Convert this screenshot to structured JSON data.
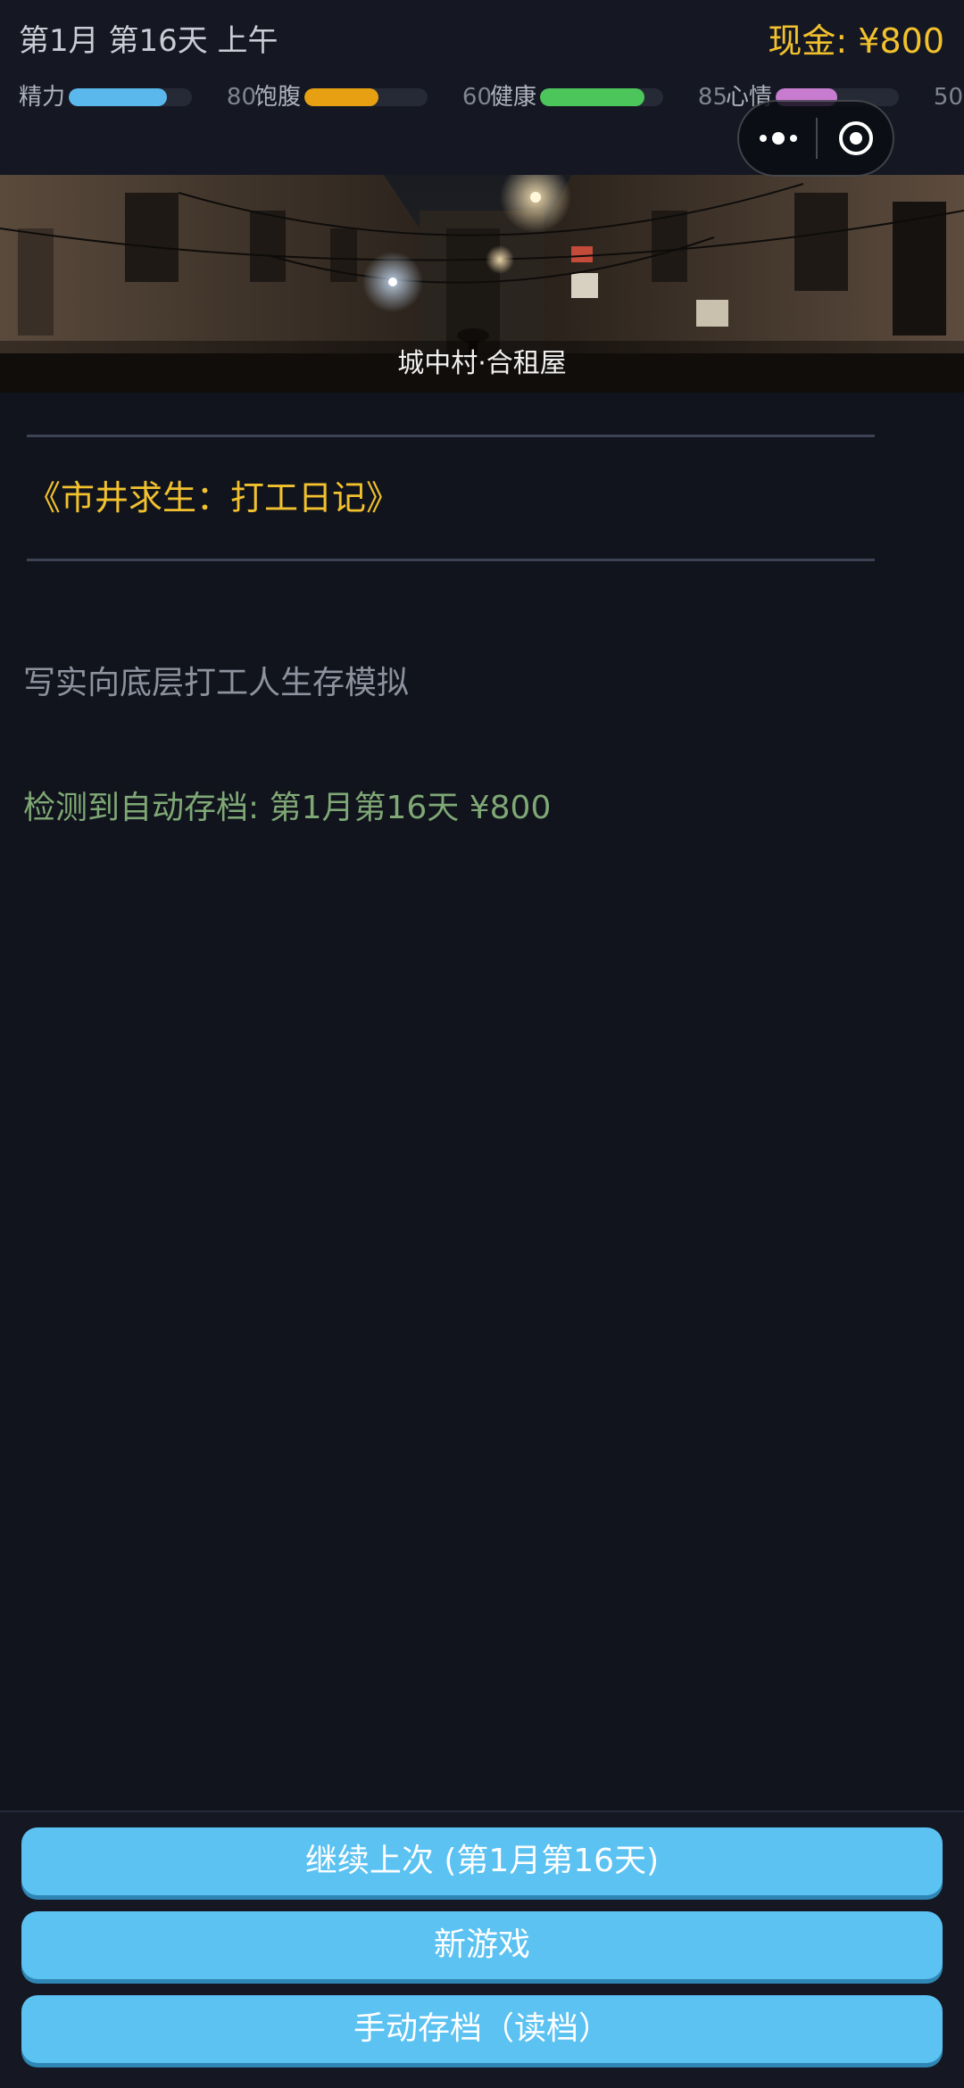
{
  "header": {
    "date": "第1月 第16天 上午",
    "cash": "现金: ¥800"
  },
  "stats": [
    {
      "label": "精力",
      "value": "80",
      "fill": 0.8,
      "color": "#5bb8ec"
    },
    {
      "label": "饱腹",
      "value": "60",
      "fill": 0.6,
      "color": "#e6a012"
    },
    {
      "label": "健康",
      "value": "85",
      "fill": 0.85,
      "color": "#4cc55b"
    },
    {
      "label": "心情",
      "value": "50",
      "fill": 0.5,
      "color": "#c77cd0"
    }
  ],
  "scene": {
    "caption": "城中村·合租屋"
  },
  "content": {
    "title": "《市井求生：打工日记》",
    "subtitle": "写实向底层打工人生存模拟",
    "save_notice": "检测到自动存档: 第1月第16天 ¥800"
  },
  "buttons": {
    "continue": "继续上次 (第1月第16天)",
    "new_game": "新游戏",
    "manual_save": "手动存档（读档）"
  },
  "colors": {
    "background": "#11141c",
    "cash": "#f2c12e",
    "title": "#f2c12e",
    "save_notice": "#7fa876",
    "button": "#5bc2f2"
  },
  "icons": {
    "capsule_more": "more-dots-icon",
    "capsule_close": "close-target-icon"
  }
}
